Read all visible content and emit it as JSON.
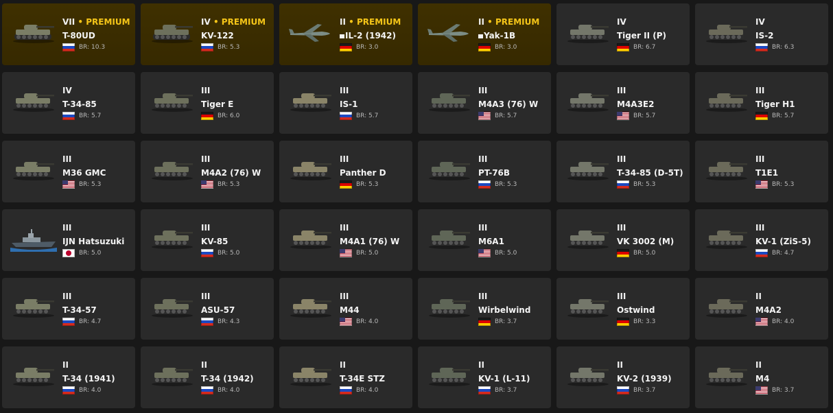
{
  "vehicles": [
    {
      "tier": "VII",
      "premium": true,
      "premium_label": "• PREMIUM",
      "name": "T-80UD",
      "nation": "ussr",
      "br": "BR: 10.3",
      "icon": "tank-icon",
      "mini_flag": false
    },
    {
      "tier": "IV",
      "premium": true,
      "premium_label": "• PREMIUM",
      "name": "KV-122",
      "nation": "ussr",
      "br": "BR: 5.3",
      "icon": "tank-icon",
      "mini_flag": false
    },
    {
      "tier": "II",
      "premium": true,
      "premium_label": "• PREMIUM",
      "name": "IL-2 (1942)",
      "nation": "germany",
      "br": "BR: 3.0",
      "icon": "plane-icon",
      "mini_flag": true
    },
    {
      "tier": "II",
      "premium": true,
      "premium_label": "• PREMIUM",
      "name": "Yak-1B",
      "nation": "germany",
      "br": "BR: 3.0",
      "icon": "plane-icon",
      "mini_flag": true
    },
    {
      "tier": "IV",
      "premium": false,
      "premium_label": "",
      "name": "Tiger II (P)",
      "nation": "germany",
      "br": "BR: 6.7",
      "icon": "tank-icon",
      "mini_flag": false
    },
    {
      "tier": "IV",
      "premium": false,
      "premium_label": "",
      "name": "IS-2",
      "nation": "ussr",
      "br": "BR: 6.3",
      "icon": "tank-icon",
      "mini_flag": false
    },
    {
      "tier": "IV",
      "premium": false,
      "premium_label": "",
      "name": "T-34-85",
      "nation": "ussr",
      "br": "BR: 5.7",
      "icon": "tank-icon",
      "mini_flag": false
    },
    {
      "tier": "III",
      "premium": false,
      "premium_label": "",
      "name": "Tiger E",
      "nation": "germany",
      "br": "BR: 6.0",
      "icon": "tank-icon",
      "mini_flag": false
    },
    {
      "tier": "III",
      "premium": false,
      "premium_label": "",
      "name": "IS-1",
      "nation": "ussr",
      "br": "BR: 5.7",
      "icon": "tank-icon",
      "mini_flag": false
    },
    {
      "tier": "III",
      "premium": false,
      "premium_label": "",
      "name": "M4A3 (76) W",
      "nation": "usa",
      "br": "BR: 5.7",
      "icon": "tank-icon",
      "mini_flag": false
    },
    {
      "tier": "III",
      "premium": false,
      "premium_label": "",
      "name": "M4A3E2",
      "nation": "usa",
      "br": "BR: 5.7",
      "icon": "tank-icon",
      "mini_flag": false
    },
    {
      "tier": "III",
      "premium": false,
      "premium_label": "",
      "name": "Tiger H1",
      "nation": "germany",
      "br": "BR: 5.7",
      "icon": "tank-icon",
      "mini_flag": false
    },
    {
      "tier": "III",
      "premium": false,
      "premium_label": "",
      "name": "M36 GMC",
      "nation": "usa",
      "br": "BR: 5.3",
      "icon": "tank-icon",
      "mini_flag": false
    },
    {
      "tier": "III",
      "premium": false,
      "premium_label": "",
      "name": "M4A2 (76) W",
      "nation": "usa",
      "br": "BR: 5.3",
      "icon": "tank-icon",
      "mini_flag": false
    },
    {
      "tier": "III",
      "premium": false,
      "premium_label": "",
      "name": "Panther D",
      "nation": "germany",
      "br": "BR: 5.3",
      "icon": "tank-icon",
      "mini_flag": false
    },
    {
      "tier": "III",
      "premium": false,
      "premium_label": "",
      "name": "PT-76B",
      "nation": "ussr",
      "br": "BR: 5.3",
      "icon": "tank-icon",
      "mini_flag": false
    },
    {
      "tier": "III",
      "premium": false,
      "premium_label": "",
      "name": "T-34-85 (D-5T)",
      "nation": "ussr",
      "br": "BR: 5.3",
      "icon": "tank-icon",
      "mini_flag": false
    },
    {
      "tier": "III",
      "premium": false,
      "premium_label": "",
      "name": "T1E1",
      "nation": "usa",
      "br": "BR: 5.3",
      "icon": "tank-icon",
      "mini_flag": false
    },
    {
      "tier": "III",
      "premium": false,
      "premium_label": "",
      "name": "IJN Hatsuzuki",
      "nation": "japan",
      "br": "BR: 5.0",
      "icon": "ship-icon",
      "mini_flag": false
    },
    {
      "tier": "III",
      "premium": false,
      "premium_label": "",
      "name": "KV-85",
      "nation": "ussr",
      "br": "BR: 5.0",
      "icon": "tank-icon",
      "mini_flag": false
    },
    {
      "tier": "III",
      "premium": false,
      "premium_label": "",
      "name": "M4A1 (76) W",
      "nation": "usa",
      "br": "BR: 5.0",
      "icon": "tank-icon",
      "mini_flag": false
    },
    {
      "tier": "III",
      "premium": false,
      "premium_label": "",
      "name": "M6A1",
      "nation": "usa",
      "br": "BR: 5.0",
      "icon": "tank-icon",
      "mini_flag": false
    },
    {
      "tier": "III",
      "premium": false,
      "premium_label": "",
      "name": "VK 3002 (M)",
      "nation": "germany",
      "br": "BR: 5.0",
      "icon": "tank-icon",
      "mini_flag": false
    },
    {
      "tier": "III",
      "premium": false,
      "premium_label": "",
      "name": "KV-1 (ZiS-5)",
      "nation": "ussr",
      "br": "BR: 4.7",
      "icon": "tank-icon",
      "mini_flag": false
    },
    {
      "tier": "III",
      "premium": false,
      "premium_label": "",
      "name": "T-34-57",
      "nation": "ussr",
      "br": "BR: 4.7",
      "icon": "tank-icon",
      "mini_flag": false
    },
    {
      "tier": "III",
      "premium": false,
      "premium_label": "",
      "name": "ASU-57",
      "nation": "ussr",
      "br": "BR: 4.3",
      "icon": "tank-icon",
      "mini_flag": false
    },
    {
      "tier": "III",
      "premium": false,
      "premium_label": "",
      "name": "M44",
      "nation": "usa",
      "br": "BR: 4.0",
      "icon": "tank-icon",
      "mini_flag": false
    },
    {
      "tier": "III",
      "premium": false,
      "premium_label": "",
      "name": "Wirbelwind",
      "nation": "germany",
      "br": "BR: 3.7",
      "icon": "tank-icon",
      "mini_flag": false
    },
    {
      "tier": "III",
      "premium": false,
      "premium_label": "",
      "name": "Ostwind",
      "nation": "germany",
      "br": "BR: 3.3",
      "icon": "tank-icon",
      "mini_flag": false
    },
    {
      "tier": "II",
      "premium": false,
      "premium_label": "",
      "name": "M4A2",
      "nation": "usa",
      "br": "BR: 4.0",
      "icon": "tank-icon",
      "mini_flag": false
    },
    {
      "tier": "II",
      "premium": false,
      "premium_label": "",
      "name": "T-34 (1941)",
      "nation": "ussr",
      "br": "BR: 4.0",
      "icon": "tank-icon",
      "mini_flag": false
    },
    {
      "tier": "II",
      "premium": false,
      "premium_label": "",
      "name": "T-34 (1942)",
      "nation": "ussr",
      "br": "BR: 4.0",
      "icon": "tank-icon",
      "mini_flag": false
    },
    {
      "tier": "II",
      "premium": false,
      "premium_label": "",
      "name": "T-34E STZ",
      "nation": "ussr",
      "br": "BR: 4.0",
      "icon": "tank-icon",
      "mini_flag": false
    },
    {
      "tier": "II",
      "premium": false,
      "premium_label": "",
      "name": "KV-1 (L-11)",
      "nation": "ussr",
      "br": "BR: 3.7",
      "icon": "tank-icon",
      "mini_flag": false
    },
    {
      "tier": "II",
      "premium": false,
      "premium_label": "",
      "name": "KV-2 (1939)",
      "nation": "ussr",
      "br": "BR: 3.7",
      "icon": "tank-icon",
      "mini_flag": false
    },
    {
      "tier": "II",
      "premium": false,
      "premium_label": "",
      "name": "M4",
      "nation": "usa",
      "br": "BR: 3.7",
      "icon": "tank-icon",
      "mini_flag": false
    }
  ]
}
